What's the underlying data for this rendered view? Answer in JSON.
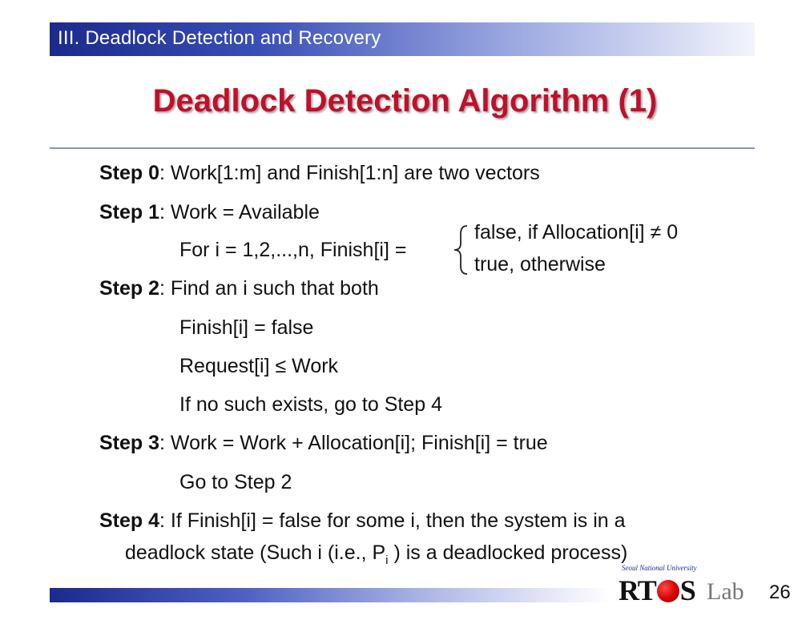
{
  "header": {
    "title": "III. Deadlock Detection and Recovery"
  },
  "slide": {
    "title": "Deadlock Detection Algorithm (1)"
  },
  "steps": {
    "s0": {
      "label": "Step 0",
      "text": ": Work[1:m] and Finish[1:n] are two vectors"
    },
    "s1": {
      "label": "Step 1",
      "text": ": Work = Available",
      "for_line": "For i = 1,2,...,n, Finish[i] =",
      "case1": "false, if Allocation[i] ≠ 0",
      "case2": "true, otherwise"
    },
    "s2": {
      "label": "Step 2",
      "text": ": Find an i such that both",
      "line1": "Finish[i] = false",
      "line2": "Request[i] ≤ Work",
      "line3": "If no such exists, go to Step 4"
    },
    "s3": {
      "label": "Step 3",
      "text": ": Work = Work + Allocation[i]; Finish[i] = true",
      "line1": "Go to Step 2"
    },
    "s4": {
      "label": "Step 4",
      "text": ": If Finish[i] = false for some i, then the system is in a",
      "cont_prefix": "deadlock state (Such i (i.e., P",
      "cont_sub": "i",
      "cont_suffix": " ) is a deadlocked process)"
    }
  },
  "footer": {
    "logo_univ": "Seoul National University",
    "logo_rt": "RT",
    "logo_s": "S",
    "logo_lab": "Lab",
    "page_number": "26"
  },
  "colors": {
    "title_red": "#c0102a",
    "header_blue": "#1b2a8c"
  }
}
